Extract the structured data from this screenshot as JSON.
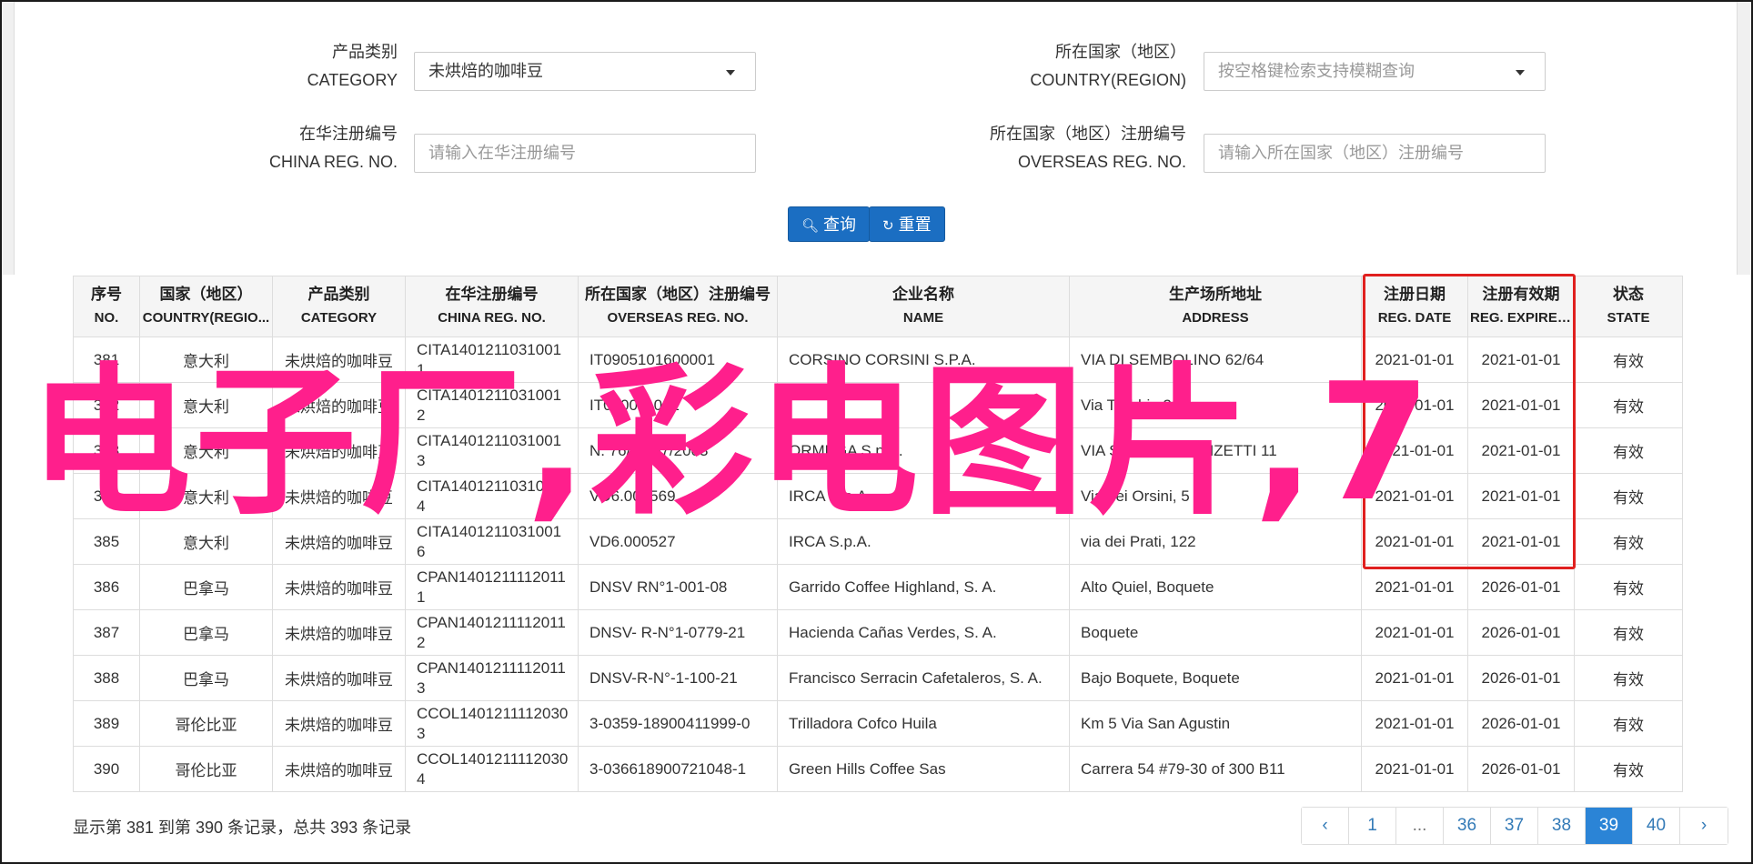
{
  "filters": {
    "category_label_cn": "产品类别",
    "category_label_en": "CATEGORY",
    "category_value": "未烘焙的咖啡豆",
    "country_label_cn": "所在国家（地区）",
    "country_label_en": "COUNTRY(REGION)",
    "country_placeholder": "按空格键检索支持模糊查询",
    "china_reg_label_cn": "在华注册编号",
    "china_reg_label_en": "CHINA REG. NO.",
    "china_reg_placeholder": "请输入在华注册编号",
    "overseas_reg_label_cn": "所在国家（地区）注册编号",
    "overseas_reg_label_en": "OVERSEAS REG. NO.",
    "overseas_reg_placeholder": "请输入所在国家（地区）注册编号"
  },
  "buttons": {
    "search_label": "查询",
    "reset_label": "重置"
  },
  "table": {
    "headers": [
      {
        "cn": "序号",
        "en": "NO."
      },
      {
        "cn": "国家（地区）",
        "en": "COUNTRY(REGIO..."
      },
      {
        "cn": "产品类别",
        "en": "CATEGORY"
      },
      {
        "cn": "在华注册编号",
        "en": "CHINA REG. NO."
      },
      {
        "cn": "所在国家（地区）注册编号",
        "en": "OVERSEAS REG. NO."
      },
      {
        "cn": "企业名称",
        "en": "NAME"
      },
      {
        "cn": "生产场所地址",
        "en": "ADDRESS"
      },
      {
        "cn": "注册日期",
        "en": "REG. DATE"
      },
      {
        "cn": "注册有效期",
        "en": "REG. EXPIRE ..."
      },
      {
        "cn": "状态",
        "en": "STATE"
      }
    ],
    "rows": [
      [
        "381",
        "意大利",
        "未烘焙的咖啡豆",
        "CITA14012110310011",
        "IT0905101600001",
        "CORSINO CORSINI S.P.A.",
        "VIA DI SEMBOLINO 62/64",
        "2021-01-01",
        "2021-01-01",
        "有效"
      ],
      [
        "382",
        "意大利",
        "未烘焙的咖啡豆",
        "CITA14012110310012",
        "IT050011001",
        "",
        "Via Trebbia 21",
        "2021-01-01",
        "2021-01-01",
        "有效"
      ],
      [
        "383",
        "意大利",
        "未烘焙的咖啡豆",
        "CITA14012110310013",
        "N. 76/09/07/2003",
        "ORMEGA S.p.A.",
        "VIA SACCO E VANZETTI 11",
        "2021-01-01",
        "2021-01-01",
        "有效"
      ],
      [
        "384",
        "意大利",
        "未烘焙的咖啡豆",
        "CITA14012110310014",
        "VD6.000569",
        "IRCA S.p.A.",
        "Via dei Orsini, 5",
        "2021-01-01",
        "2021-01-01",
        "有效"
      ],
      [
        "385",
        "意大利",
        "未烘焙的咖啡豆",
        "CITA14012110310016",
        "VD6.000527",
        "IRCA S.p.A.",
        "via dei Prati, 122",
        "2021-01-01",
        "2021-01-01",
        "有效"
      ],
      [
        "386",
        "巴拿马",
        "未烘焙的咖啡豆",
        "CPAN14012111120111",
        "DNSV RN°1-001-08",
        "Garrido Coffee Highland, S. A.",
        "Alto Quiel, Boquete",
        "2021-01-01",
        "2026-01-01",
        "有效"
      ],
      [
        "387",
        "巴拿马",
        "未烘焙的咖啡豆",
        "CPAN14012111120112",
        "DNSV- R-N°1-0779-21",
        "Hacienda Cañas Verdes, S. A.",
        "Boquete",
        "2021-01-01",
        "2026-01-01",
        "有效"
      ],
      [
        "388",
        "巴拿马",
        "未烘焙的咖啡豆",
        "CPAN14012111120113",
        "DNSV-R-N°-1-100-21",
        "Francisco Serracin Cafetaleros, S. A.",
        "Bajo Boquete, Boquete",
        "2021-01-01",
        "2026-01-01",
        "有效"
      ],
      [
        "389",
        "哥伦比亚",
        "未烘焙的咖啡豆",
        "CCOL14012111120303",
        "3-0359-18900411999-0",
        "Trilladora Cofco Huila",
        "Km 5 Via San Agustin",
        "2021-01-01",
        "2026-01-01",
        "有效"
      ],
      [
        "390",
        "哥伦比亚",
        "未烘焙的咖啡豆",
        "CCOL14012111120304",
        "3-036618900721048-1",
        "Green Hills Coffee Sas",
        "Carrera 54 #79-30 of 300 B11",
        "2021-01-01",
        "2026-01-01",
        "有效"
      ]
    ]
  },
  "overlay_text": "电子厂,彩电图片,7",
  "footer": {
    "summary": "显示第 381 到第 390 条记录，总共 393 条记录"
  },
  "pagination": {
    "items": [
      "‹",
      "1",
      "...",
      "36",
      "37",
      "38",
      "39",
      "40",
      "›"
    ],
    "active": "39"
  },
  "colors": {
    "primary": "#1b6ec2",
    "active_page": "#2b84d6",
    "highlight_box": "#e0201f",
    "overlay": "#ff1f8c"
  }
}
